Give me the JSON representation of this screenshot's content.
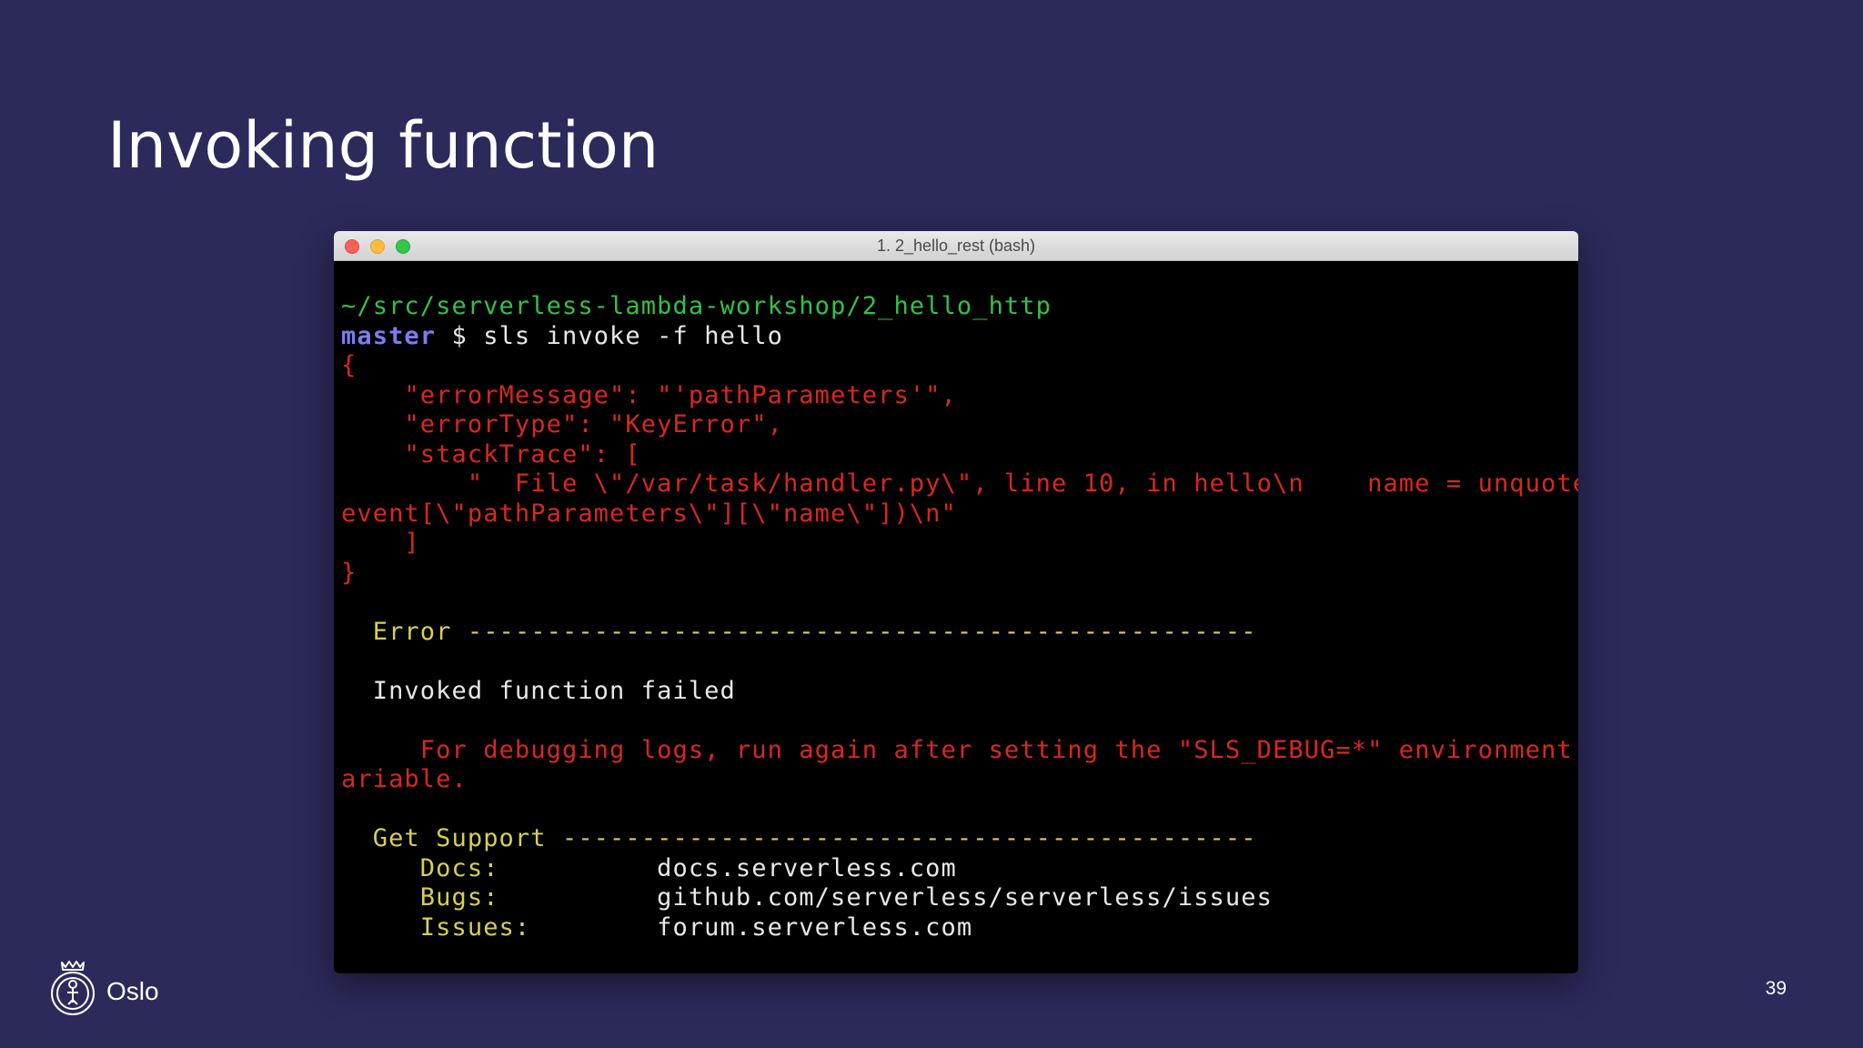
{
  "slide": {
    "title": "Invoking function",
    "page_number": "39"
  },
  "brand": {
    "name": "Oslo",
    "logo_icon": "oslo-city-seal-icon"
  },
  "terminal": {
    "window_title": "1. 2_hello_rest (bash)",
    "prompt_path": "~/src/serverless-lambda-workshop/2_hello_http",
    "prompt_branch": "master",
    "prompt_symbol": " $ ",
    "command": "sls invoke -f hello",
    "json_output": [
      "{",
      "    \"errorMessage\": \"'pathParameters'\",",
      "    \"errorType\": \"KeyError\",",
      "    \"stackTrace\": [",
      "        \"  File \\\"/var/task/handler.py\\\", line 10, in hello\\n    name = unquote(",
      "event[\\\"pathParameters\\\"][\\\"name\\\"])\\n\"",
      "    ]",
      "}"
    ],
    "error_header": "  Error --------------------------------------------------",
    "error_message": "  Invoked function failed",
    "debug_hint": [
      "     For debugging logs, run again after setting the \"SLS_DEBUG=*\" environment v",
      "ariable."
    ],
    "support_header": "  Get Support --------------------------------------------",
    "support_rows": [
      {
        "label": "     Docs:          ",
        "value": "docs.serverless.com"
      },
      {
        "label": "     Bugs:          ",
        "value": "github.com/serverless/serverless/issues"
      },
      {
        "label": "     Issues:        ",
        "value": "forum.serverless.com"
      }
    ]
  },
  "colors": {
    "background": "#2c2a5a",
    "terminal_background": "#000000",
    "path_green": "#33c245",
    "branch_blue": "#7a7ef0",
    "error_red": "#d8281e",
    "label_yellow": "#d6cf55",
    "text_white": "#e8e8e8"
  }
}
